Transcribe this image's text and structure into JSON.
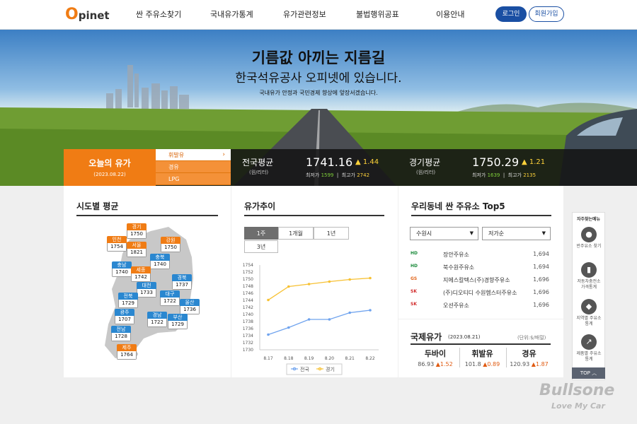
{
  "header": {
    "logo_o": "O",
    "logo_rest": "pinet",
    "nav": [
      "싼 주유소찾기",
      "국내유가통계",
      "유가관련정보",
      "불법행위공표",
      "이용안내"
    ],
    "login": "로그인",
    "join": "회원가입"
  },
  "hero": {
    "title1": "기름값 아끼는 지름길",
    "title2": "한국석유공사 오피넷에 있습니다.",
    "subtitle": "국내유가 안정과 국민경제 향상에 앞장서겠습니다."
  },
  "pricebar": {
    "today_label": "오늘의 유가",
    "today_date": "(2023.08.22)",
    "fuel_tabs": [
      "휘발유",
      "경유",
      "LPG"
    ],
    "national": {
      "label": "전국평균",
      "unit": "(원/리터)",
      "price": "1741.16",
      "change": "1.44",
      "min_label": "최저가",
      "min": "1599",
      "max_label": "최고가",
      "max": "2742"
    },
    "gyeonggi": {
      "label": "경기평균",
      "unit": "(원/리터)",
      "price": "1750.29",
      "change": "1.21",
      "min_label": "최저가",
      "min": "1639",
      "max_label": "최고가",
      "max": "2135"
    }
  },
  "region": {
    "title": "시도별 평균",
    "tags": [
      {
        "name": "경기",
        "value": "1750"
      },
      {
        "name": "인천",
        "value": "1754"
      },
      {
        "name": "서울",
        "value": "1821"
      },
      {
        "name": "강원",
        "value": "1750"
      },
      {
        "name": "충북",
        "value": "1740"
      },
      {
        "name": "충남",
        "value": "1740"
      },
      {
        "name": "세종",
        "value": "1742"
      },
      {
        "name": "경북",
        "value": "1737"
      },
      {
        "name": "대전",
        "value": "1733"
      },
      {
        "name": "전북",
        "value": "1729"
      },
      {
        "name": "대구",
        "value": "1722"
      },
      {
        "name": "울산",
        "value": "1736"
      },
      {
        "name": "광주",
        "value": "1707"
      },
      {
        "name": "경남",
        "value": "1722"
      },
      {
        "name": "부산",
        "value": "1729"
      },
      {
        "name": "전남",
        "value": "1728"
      },
      {
        "name": "제주",
        "value": "1764"
      }
    ]
  },
  "trend": {
    "title": "유가추이",
    "periods": [
      "1주",
      "1개월",
      "1년",
      "3년"
    ],
    "legend": [
      "전국",
      "경기"
    ]
  },
  "chart_data": {
    "type": "line",
    "x": [
      "8.17",
      "8.18",
      "8.19",
      "8.20",
      "8.21",
      "8.22"
    ],
    "series": [
      {
        "name": "전국",
        "values": [
          1734.3,
          1736.3,
          1738.6,
          1738.6,
          1740.5,
          1741.2
        ]
      },
      {
        "name": "경기",
        "values": [
          1744.1,
          1747.9,
          1748.6,
          1749.3,
          1749.9,
          1750.3
        ]
      }
    ],
    "ylim": [
      1730,
      1754
    ],
    "yticks": [
      "1754",
      "1752",
      "1750",
      "1748",
      "1746",
      "1744",
      "1742",
      "1740",
      "1738",
      "1736",
      "1734",
      "1732",
      "1730"
    ],
    "colors": {
      "전국": "#6fa3ee",
      "경기": "#f7c133"
    },
    "grid": false,
    "legend": "bottom"
  },
  "cheap": {
    "title": "우리동네 싼 주유소 Top5",
    "region_select": "수원시",
    "sort_select": "저가순",
    "stations": [
      {
        "brand": "HD",
        "name": "장안주유소",
        "price": "1,694"
      },
      {
        "brand": "HD",
        "name": "북수원주유소",
        "price": "1,694"
      },
      {
        "brand": "GS",
        "name": "지에스칼텍스(주)경향주유소",
        "price": "1,696"
      },
      {
        "brand": "SK",
        "name": "(주)디오티디 수원헴스터주유소",
        "price": "1,696"
      },
      {
        "brand": "SK",
        "name": "오션주유소",
        "price": "1,696"
      }
    ]
  },
  "intl": {
    "title": "국제유가",
    "date": "(2023.08.21)",
    "unit": "(단위:$/배럴)",
    "items": [
      {
        "name": "두바이",
        "price": "86.93",
        "change": "1.52"
      },
      {
        "name": "휘발유",
        "price": "101.8",
        "change": "0.89"
      },
      {
        "name": "경유",
        "price": "120.93",
        "change": "1.87"
      }
    ]
  },
  "side": {
    "title": "자주찾는메뉴",
    "items": [
      "반주유소 찾기",
      "저동차충전소 가격통계",
      "지역별 주유소통계",
      "제품별 주유소통계"
    ],
    "top": "TOP"
  },
  "watermark": {
    "line1": "Bullsone",
    "line2": "Love My Car"
  }
}
